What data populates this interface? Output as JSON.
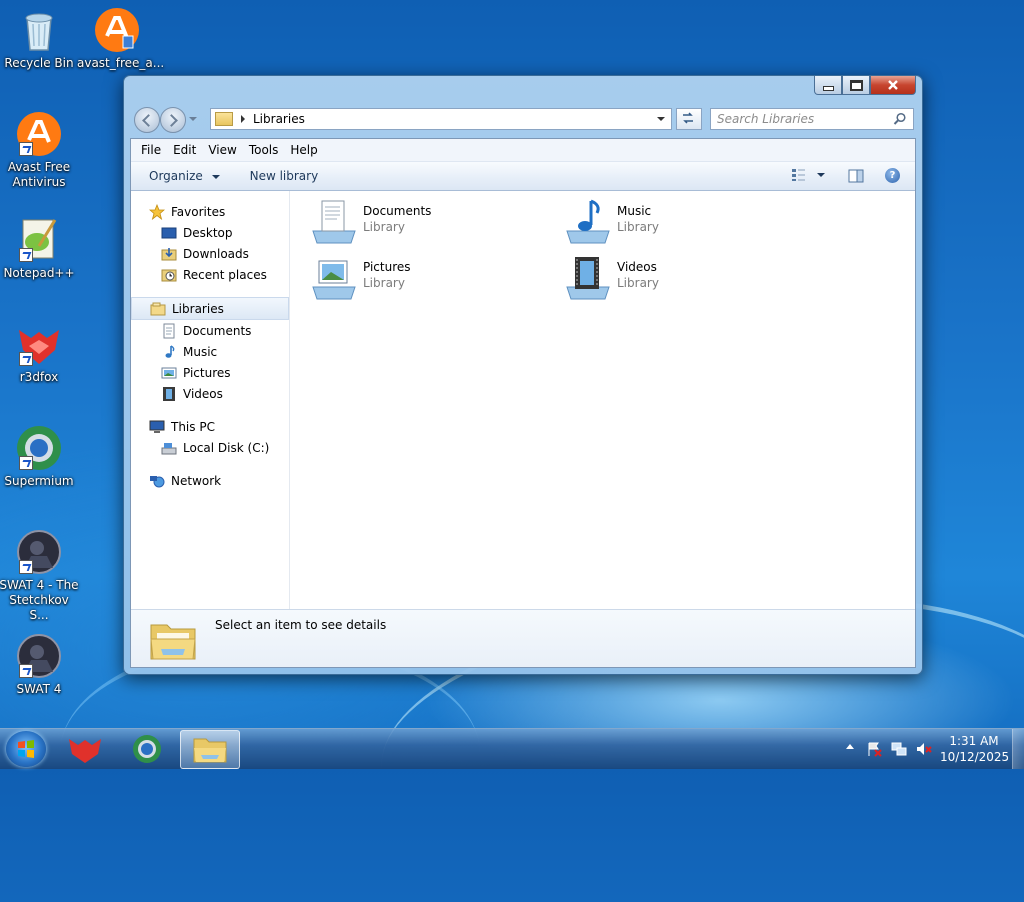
{
  "desktop": {
    "icons": [
      {
        "label": "Recycle Bin"
      },
      {
        "label": "avast_free_a..."
      },
      {
        "label": "Avast Free Antivirus"
      },
      {
        "label": "Notepad++"
      },
      {
        "label": "r3dfox"
      },
      {
        "label": "Supermium"
      },
      {
        "label": "SWAT 4 - The Stetchkov S..."
      },
      {
        "label": "SWAT 4"
      }
    ]
  },
  "explorer": {
    "address": {
      "location": "Libraries"
    },
    "search": {
      "placeholder": "Search Libraries"
    },
    "menu": [
      "File",
      "Edit",
      "View",
      "Tools",
      "Help"
    ],
    "commands": {
      "organize": "Organize",
      "new_library": "New library"
    },
    "nav": {
      "favorites": {
        "label": "Favorites",
        "items": [
          "Desktop",
          "Downloads",
          "Recent places"
        ]
      },
      "libraries": {
        "label": "Libraries",
        "items": [
          "Documents",
          "Music",
          "Pictures",
          "Videos"
        ]
      },
      "computer": {
        "label": "This PC",
        "items": [
          "Local Disk (C:)"
        ]
      },
      "network": {
        "label": "Network"
      }
    },
    "libraries": [
      {
        "name": "Documents",
        "type": "Library"
      },
      {
        "name": "Music",
        "type": "Library"
      },
      {
        "name": "Pictures",
        "type": "Library"
      },
      {
        "name": "Videos",
        "type": "Library"
      }
    ],
    "details": {
      "text": "Select an item to see details"
    }
  },
  "taskbar": {
    "clock": {
      "time": "1:31 AM",
      "date": "10/12/2025"
    }
  }
}
